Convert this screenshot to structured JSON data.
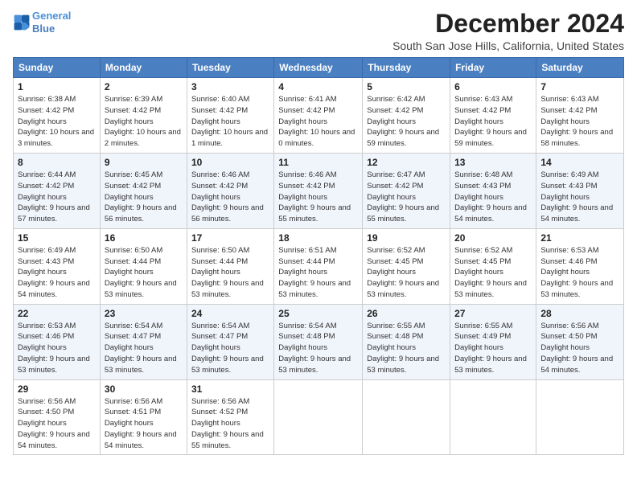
{
  "logo": {
    "line1": "General",
    "line2": "Blue"
  },
  "header": {
    "month": "December 2024",
    "location": "South San Jose Hills, California, United States"
  },
  "weekdays": [
    "Sunday",
    "Monday",
    "Tuesday",
    "Wednesday",
    "Thursday",
    "Friday",
    "Saturday"
  ],
  "weeks": [
    [
      {
        "day": "1",
        "sunrise": "Sunrise: 6:38 AM",
        "sunset": "Sunset: 4:42 PM",
        "daylight": "Daylight: 10 hours and 3 minutes."
      },
      {
        "day": "2",
        "sunrise": "Sunrise: 6:39 AM",
        "sunset": "Sunset: 4:42 PM",
        "daylight": "Daylight: 10 hours and 2 minutes."
      },
      {
        "day": "3",
        "sunrise": "Sunrise: 6:40 AM",
        "sunset": "Sunset: 4:42 PM",
        "daylight": "Daylight: 10 hours and 1 minute."
      },
      {
        "day": "4",
        "sunrise": "Sunrise: 6:41 AM",
        "sunset": "Sunset: 4:42 PM",
        "daylight": "Daylight: 10 hours and 0 minutes."
      },
      {
        "day": "5",
        "sunrise": "Sunrise: 6:42 AM",
        "sunset": "Sunset: 4:42 PM",
        "daylight": "Daylight: 9 hours and 59 minutes."
      },
      {
        "day": "6",
        "sunrise": "Sunrise: 6:43 AM",
        "sunset": "Sunset: 4:42 PM",
        "daylight": "Daylight: 9 hours and 59 minutes."
      },
      {
        "day": "7",
        "sunrise": "Sunrise: 6:43 AM",
        "sunset": "Sunset: 4:42 PM",
        "daylight": "Daylight: 9 hours and 58 minutes."
      }
    ],
    [
      {
        "day": "8",
        "sunrise": "Sunrise: 6:44 AM",
        "sunset": "Sunset: 4:42 PM",
        "daylight": "Daylight: 9 hours and 57 minutes."
      },
      {
        "day": "9",
        "sunrise": "Sunrise: 6:45 AM",
        "sunset": "Sunset: 4:42 PM",
        "daylight": "Daylight: 9 hours and 56 minutes."
      },
      {
        "day": "10",
        "sunrise": "Sunrise: 6:46 AM",
        "sunset": "Sunset: 4:42 PM",
        "daylight": "Daylight: 9 hours and 56 minutes."
      },
      {
        "day": "11",
        "sunrise": "Sunrise: 6:46 AM",
        "sunset": "Sunset: 4:42 PM",
        "daylight": "Daylight: 9 hours and 55 minutes."
      },
      {
        "day": "12",
        "sunrise": "Sunrise: 6:47 AM",
        "sunset": "Sunset: 4:42 PM",
        "daylight": "Daylight: 9 hours and 55 minutes."
      },
      {
        "day": "13",
        "sunrise": "Sunrise: 6:48 AM",
        "sunset": "Sunset: 4:43 PM",
        "daylight": "Daylight: 9 hours and 54 minutes."
      },
      {
        "day": "14",
        "sunrise": "Sunrise: 6:49 AM",
        "sunset": "Sunset: 4:43 PM",
        "daylight": "Daylight: 9 hours and 54 minutes."
      }
    ],
    [
      {
        "day": "15",
        "sunrise": "Sunrise: 6:49 AM",
        "sunset": "Sunset: 4:43 PM",
        "daylight": "Daylight: 9 hours and 54 minutes."
      },
      {
        "day": "16",
        "sunrise": "Sunrise: 6:50 AM",
        "sunset": "Sunset: 4:44 PM",
        "daylight": "Daylight: 9 hours and 53 minutes."
      },
      {
        "day": "17",
        "sunrise": "Sunrise: 6:50 AM",
        "sunset": "Sunset: 4:44 PM",
        "daylight": "Daylight: 9 hours and 53 minutes."
      },
      {
        "day": "18",
        "sunrise": "Sunrise: 6:51 AM",
        "sunset": "Sunset: 4:44 PM",
        "daylight": "Daylight: 9 hours and 53 minutes."
      },
      {
        "day": "19",
        "sunrise": "Sunrise: 6:52 AM",
        "sunset": "Sunset: 4:45 PM",
        "daylight": "Daylight: 9 hours and 53 minutes."
      },
      {
        "day": "20",
        "sunrise": "Sunrise: 6:52 AM",
        "sunset": "Sunset: 4:45 PM",
        "daylight": "Daylight: 9 hours and 53 minutes."
      },
      {
        "day": "21",
        "sunrise": "Sunrise: 6:53 AM",
        "sunset": "Sunset: 4:46 PM",
        "daylight": "Daylight: 9 hours and 53 minutes."
      }
    ],
    [
      {
        "day": "22",
        "sunrise": "Sunrise: 6:53 AM",
        "sunset": "Sunset: 4:46 PM",
        "daylight": "Daylight: 9 hours and 53 minutes."
      },
      {
        "day": "23",
        "sunrise": "Sunrise: 6:54 AM",
        "sunset": "Sunset: 4:47 PM",
        "daylight": "Daylight: 9 hours and 53 minutes."
      },
      {
        "day": "24",
        "sunrise": "Sunrise: 6:54 AM",
        "sunset": "Sunset: 4:47 PM",
        "daylight": "Daylight: 9 hours and 53 minutes."
      },
      {
        "day": "25",
        "sunrise": "Sunrise: 6:54 AM",
        "sunset": "Sunset: 4:48 PM",
        "daylight": "Daylight: 9 hours and 53 minutes."
      },
      {
        "day": "26",
        "sunrise": "Sunrise: 6:55 AM",
        "sunset": "Sunset: 4:48 PM",
        "daylight": "Daylight: 9 hours and 53 minutes."
      },
      {
        "day": "27",
        "sunrise": "Sunrise: 6:55 AM",
        "sunset": "Sunset: 4:49 PM",
        "daylight": "Daylight: 9 hours and 53 minutes."
      },
      {
        "day": "28",
        "sunrise": "Sunrise: 6:56 AM",
        "sunset": "Sunset: 4:50 PM",
        "daylight": "Daylight: 9 hours and 54 minutes."
      }
    ],
    [
      {
        "day": "29",
        "sunrise": "Sunrise: 6:56 AM",
        "sunset": "Sunset: 4:50 PM",
        "daylight": "Daylight: 9 hours and 54 minutes."
      },
      {
        "day": "30",
        "sunrise": "Sunrise: 6:56 AM",
        "sunset": "Sunset: 4:51 PM",
        "daylight": "Daylight: 9 hours and 54 minutes."
      },
      {
        "day": "31",
        "sunrise": "Sunrise: 6:56 AM",
        "sunset": "Sunset: 4:52 PM",
        "daylight": "Daylight: 9 hours and 55 minutes."
      },
      null,
      null,
      null,
      null
    ]
  ]
}
